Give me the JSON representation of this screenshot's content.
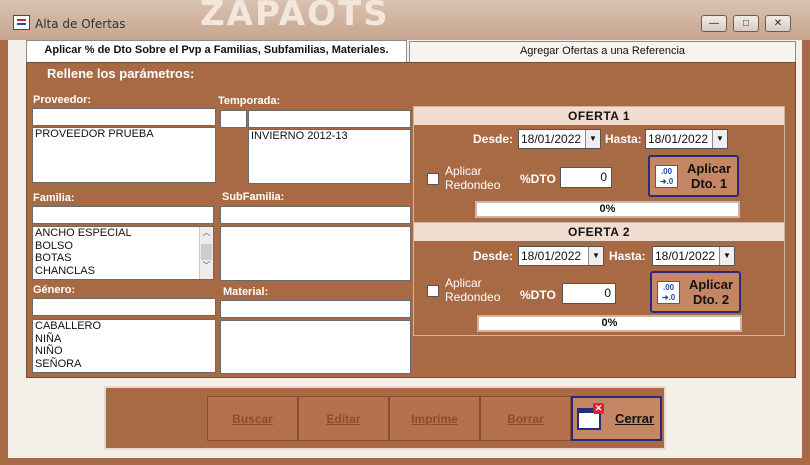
{
  "window": {
    "title": "Alta de Ofertas",
    "logo_text": "ZAPAOTS",
    "minimize": "—",
    "maximize": "□",
    "close": "✕"
  },
  "tabs": [
    {
      "label": "Aplicar % de Dto Sobre el Pvp a Familias, Subfamilias, Materiales."
    },
    {
      "label": "Agregar Ofertas a una Referencia"
    }
  ],
  "form": {
    "heading": "Rellene los parámetros:",
    "proveedor": {
      "label": "Proveedor:",
      "filter": "",
      "items": [
        "PROVEEDOR PRUEBA"
      ]
    },
    "temporada": {
      "label": "Temporada:",
      "code": "",
      "filter": "",
      "items": [
        "INVIERNO 2012-13"
      ]
    },
    "familia": {
      "label": "Familia:",
      "filter": "",
      "items": [
        "ANCHO ESPECIAL",
        "BOLSO",
        "BOTAS",
        "CHANCLAS"
      ]
    },
    "subfamilia": {
      "label": "SubFamilia:",
      "filter": "",
      "items": []
    },
    "genero": {
      "label": "Género:",
      "filter": "",
      "items": [
        "CABALLERO",
        "NIÑA",
        "NIÑO",
        "SEÑORA"
      ]
    },
    "material": {
      "label": "Material:",
      "filter": "",
      "items": []
    }
  },
  "ofertas": [
    {
      "title": "OFERTA 1",
      "desde_label": "Desde:",
      "desde": "18/01/2022",
      "hasta_label": "Hasta:",
      "hasta": "18/01/2022",
      "redondeo_label_1": "Aplicar",
      "redondeo_label_2": "Redondeo",
      "dto_label": "%DTO",
      "dto_value": "0",
      "apply_label_1": "Aplicar",
      "apply_label_2": "Dto. 1",
      "progress": "0%"
    },
    {
      "title": "OFERTA 2",
      "desde_label": "Desde:",
      "desde": "18/01/2022",
      "hasta_label": "Hasta:",
      "hasta": "18/01/2022",
      "redondeo_label_1": "Aplicar",
      "redondeo_label_2": "Redondeo",
      "dto_label": "%DTO",
      "dto_value": "0",
      "apply_label_1": "Aplicar",
      "apply_label_2": "Dto. 2",
      "progress": "0%"
    }
  ],
  "toolbar": {
    "buscar": "Buscar",
    "editar": "Editar",
    "imprime": "Imprime",
    "borrar": "Borrar",
    "cerrar": "Cerrar"
  }
}
